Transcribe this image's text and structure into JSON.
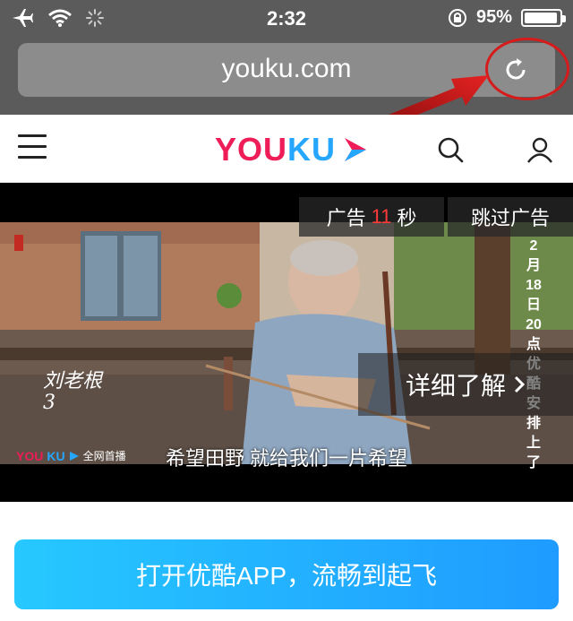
{
  "status_bar": {
    "time": "2:32",
    "battery": "95%",
    "battery_level": 0.95,
    "icons": [
      "airplane-icon",
      "wifi-icon",
      "activity-spinner-icon",
      "rotation-lock-icon",
      "battery-icon"
    ]
  },
  "browser": {
    "url": "youku.com",
    "reload_icon": "reload-icon",
    "annotation_color": "#d51b1b"
  },
  "site_header": {
    "logo_you": "YOU",
    "logo_ku": "KU",
    "menu_icon": "hamburger-menu-icon",
    "search_icon": "search-icon",
    "user_icon": "user-icon",
    "brand_colors": {
      "you": "#ee1c57",
      "ku": "#25a7ff"
    }
  },
  "video": {
    "ad_label": "广告",
    "ad_seconds": "11",
    "ad_unit": "秒",
    "skip_label": "跳过广告",
    "details_label": "详细了解",
    "subtitle": "希望田野 就给我们一片希望",
    "calligraphy": "刘老根3",
    "corner_logo_you": "YOU",
    "corner_logo_ku": "KU",
    "corner_caption": "全网首播",
    "vertical_text": "2月18日20点优酷安排上了"
  },
  "cta": {
    "label": "打开优酷APP，流畅到起飞",
    "gradient": [
      "#26c8ff",
      "#1f9bff"
    ]
  }
}
